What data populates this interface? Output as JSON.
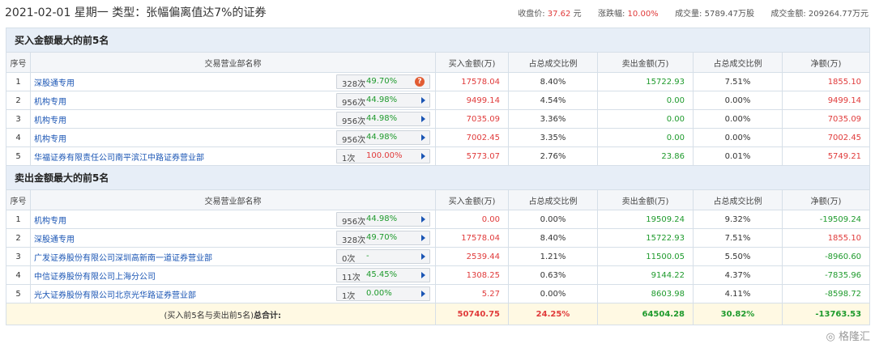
{
  "header": {
    "date_line": "2021-02-01 星期一  类型：张幅偏离值达7%的证券",
    "close_label": "收盘价:",
    "close_value": "37.62",
    "close_unit": "元",
    "change_label": "涨跌幅:",
    "change_value": "10.00%",
    "volume_label": "成交量:",
    "volume_value": "5789.47万股",
    "amount_label": "成交金额:",
    "amount_value": "209264.77万元"
  },
  "columns": [
    "序号",
    "交易营业部名称",
    "买入金额(万)",
    "占总成交比例",
    "卖出金额(万)",
    "占总成交比例",
    "净额(万)"
  ],
  "buy_section": {
    "title": "买入金额最大的前5名",
    "rows": [
      {
        "idx": "1",
        "name": "深股通专用",
        "count": "328次",
        "pct": "49.70%",
        "buy": "17578.04",
        "buy_ratio": "8.40%",
        "sell": "15722.93",
        "sell_ratio": "7.51%",
        "net": "1855.10"
      },
      {
        "idx": "2",
        "name": "机构专用",
        "count": "956次",
        "pct": "44.98%",
        "buy": "9499.14",
        "buy_ratio": "4.54%",
        "sell": "0.00",
        "sell_ratio": "0.00%",
        "net": "9499.14"
      },
      {
        "idx": "3",
        "name": "机构专用",
        "count": "956次",
        "pct": "44.98%",
        "buy": "7035.09",
        "buy_ratio": "3.36%",
        "sell": "0.00",
        "sell_ratio": "0.00%",
        "net": "7035.09"
      },
      {
        "idx": "4",
        "name": "机构专用",
        "count": "956次",
        "pct": "44.98%",
        "buy": "7002.45",
        "buy_ratio": "3.35%",
        "sell": "0.00",
        "sell_ratio": "0.00%",
        "net": "7002.45"
      },
      {
        "idx": "5",
        "name": "华福证券有限责任公司南平滨江中路证券营业部",
        "count": "1次",
        "pct": "100.00%",
        "buy": "5773.07",
        "buy_ratio": "2.76%",
        "sell": "23.86",
        "sell_ratio": "0.01%",
        "net": "5749.21"
      }
    ]
  },
  "sell_section": {
    "title": "卖出金额最大的前5名",
    "rows": [
      {
        "idx": "1",
        "name": "机构专用",
        "count": "956次",
        "pct": "44.98%",
        "buy": "0.00",
        "buy_ratio": "0.00%",
        "sell": "19509.24",
        "sell_ratio": "9.32%",
        "net": "-19509.24"
      },
      {
        "idx": "2",
        "name": "深股通专用",
        "count": "328次",
        "pct": "49.70%",
        "buy": "17578.04",
        "buy_ratio": "8.40%",
        "sell": "15722.93",
        "sell_ratio": "7.51%",
        "net": "1855.10"
      },
      {
        "idx": "3",
        "name": "广发证券股份有限公司深圳高新南一道证券营业部",
        "count": "0次",
        "pct": "-",
        "buy": "2539.44",
        "buy_ratio": "1.21%",
        "sell": "11500.05",
        "sell_ratio": "5.50%",
        "net": "-8960.60"
      },
      {
        "idx": "4",
        "name": "中信证券股份有限公司上海分公司",
        "count": "11次",
        "pct": "45.45%",
        "buy": "1308.25",
        "buy_ratio": "0.63%",
        "sell": "9144.22",
        "sell_ratio": "4.37%",
        "net": "-7835.96"
      },
      {
        "idx": "5",
        "name": "光大证券股份有限公司北京光华路证券营业部",
        "count": "1次",
        "pct": "0.00%",
        "buy": "5.27",
        "buy_ratio": "0.00%",
        "sell": "8603.98",
        "sell_ratio": "4.11%",
        "net": "-8598.72"
      }
    ]
  },
  "total": {
    "label_prefix": "(买入前5名与卖出前5名)",
    "label_bold": "总合计:",
    "buy": "50740.75",
    "buy_ratio": "24.25%",
    "sell": "64504.28",
    "sell_ratio": "30.82%",
    "net": "-13763.53"
  },
  "logo_text": "格隆汇"
}
